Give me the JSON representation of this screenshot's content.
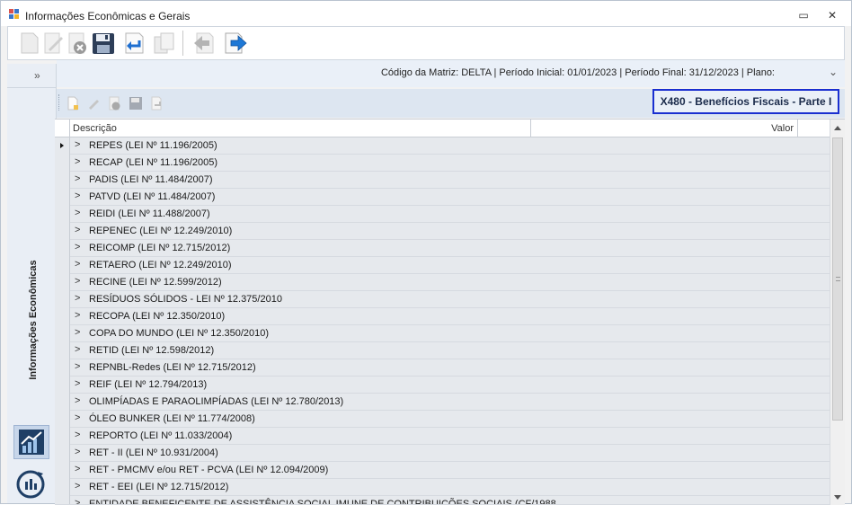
{
  "window": {
    "title": "Informações Econômicas e Gerais",
    "minimize_glyph": "▭",
    "close_glyph": "✕"
  },
  "toolbar": {
    "buttons": [
      "new-icon",
      "edit-icon",
      "delete-icon",
      "save-icon",
      "undo-icon",
      "copy-icon",
      "back-icon",
      "forward-icon"
    ]
  },
  "sidepanel": {
    "collapse_glyph": "»",
    "label": "Informações Econômicas"
  },
  "infobar": {
    "text": "Código da Matriz: DELTA | Período Inicial: 01/01/2023 | Período Final: 31/12/2023 | Plano:",
    "chevron_glyph": "⌄"
  },
  "section": {
    "title": "X480 - Benefícios Fiscais - Parte I"
  },
  "grid": {
    "columns": [
      "Descrição",
      "Valor"
    ],
    "expander_glyph": ">",
    "rows": [
      "REPES (LEI Nº 11.196/2005)",
      "RECAP (LEI Nº 11.196/2005)",
      "PADIS (LEI Nº 11.484/2007)",
      "PATVD (LEI Nº 11.484/2007)",
      "REIDI (LEI Nº 11.488/2007)",
      "REPENEC (LEI Nº 12.249/2010)",
      "REICOMP (LEI Nº 12.715/2012)",
      "RETAERO (LEI Nº 12.249/2010)",
      "RECINE (LEI Nº 12.599/2012)",
      "RESÍDUOS SÓLIDOS - LEI Nº 12.375/2010",
      "RECOPA (LEI Nº 12.350/2010)",
      "COPA DO MUNDO (LEI Nº 12.350/2010)",
      "RETID (LEI Nº 12.598/2012)",
      "REPNBL-Redes (LEI Nº 12.715/2012)",
      "REIF (LEI Nº 12.794/2013)",
      "OLIMPÍADAS E PARAOLIMPÍADAS (LEI Nº 12.780/2013)",
      "ÓLEO BUNKER (LEI Nº 11.774/2008)",
      "REPORTO (LEI Nº 11.033/2004)",
      "RET - II (LEI Nº 10.931/2004)",
      "RET - PMCMV e/ou RET - PCVA (LEI Nº 12.094/2009)",
      "RET - EEI (LEI Nº 12.715/2012)",
      "ENTIDADE BENEFICENTE DE ASSISTÊNCIA SOCIAL IMUNE DE CONTRIBUIÇÕES SOCIAIS (CF/1988"
    ]
  },
  "colors": {
    "section_border": "#1a2fd0",
    "grid_row_bg": "#e6e9ed",
    "infobar_bg": "#eaf0f8"
  }
}
